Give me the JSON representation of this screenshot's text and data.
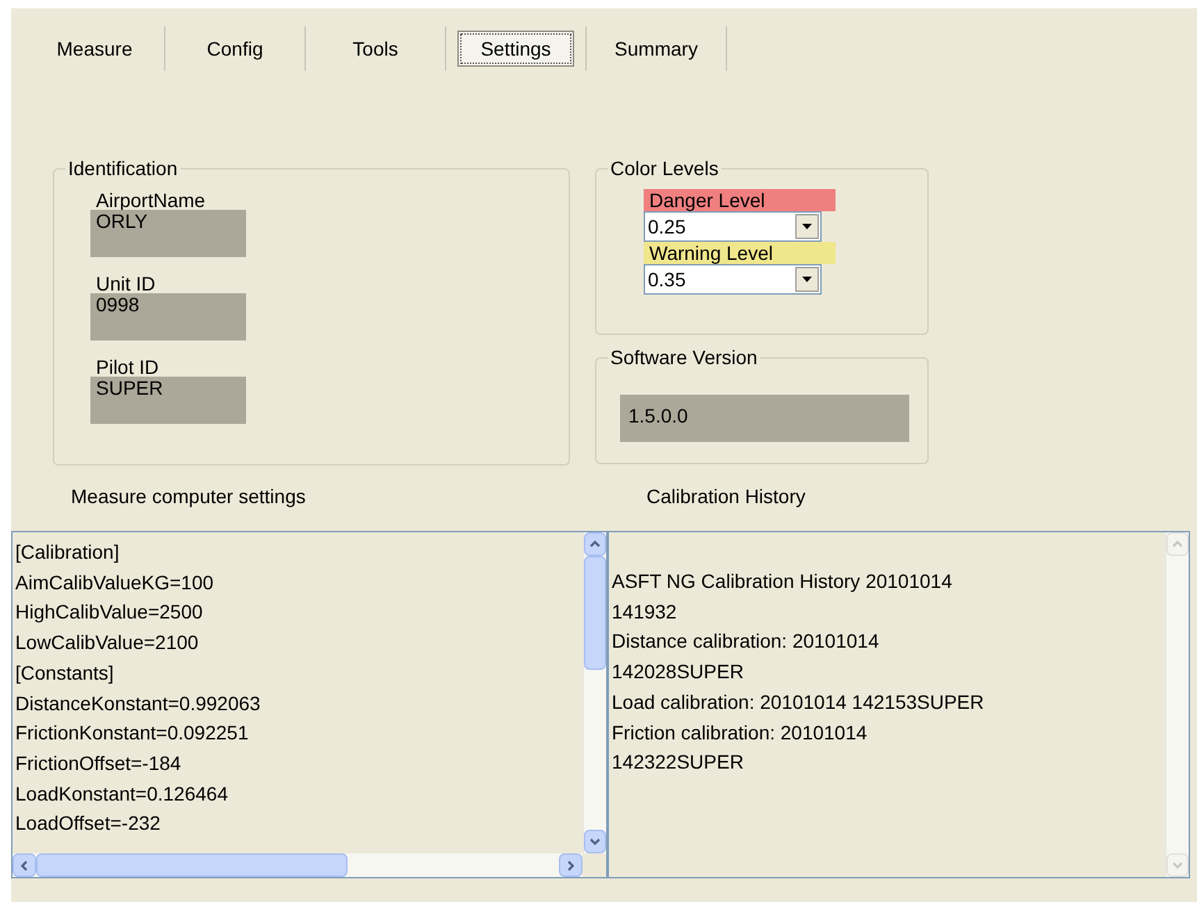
{
  "tabs": [
    {
      "label": "Measure",
      "selected": false
    },
    {
      "label": "Config",
      "selected": false
    },
    {
      "label": "Tools",
      "selected": false
    },
    {
      "label": "Settings",
      "selected": true
    },
    {
      "label": "Summary",
      "selected": false
    }
  ],
  "identification": {
    "title": "Identification",
    "fields": [
      {
        "label": "AirportName",
        "value": "ORLY"
      },
      {
        "label": "Unit ID",
        "value": "0998"
      },
      {
        "label": "Pilot ID",
        "value": "SUPER"
      }
    ]
  },
  "color_levels": {
    "title": "Color Levels",
    "levels": [
      {
        "label": "Danger Level",
        "color": "#f08080",
        "value": "0.25"
      },
      {
        "label": "Warning Level",
        "color": "#f0e68c",
        "value": "0.35"
      }
    ]
  },
  "software_version": {
    "title": "Software Version",
    "value": "1.5.0.0"
  },
  "measure_settings": {
    "title": "Measure computer settings",
    "lines": [
      "[Calibration]",
      "AimCalibValueKG=100",
      "HighCalibValue=2500",
      "LowCalibValue=2100",
      "[Constants]",
      "DistanceKonstant=0.992063",
      "FrictionKonstant=0.092251",
      "FrictionOffset=-184",
      "LoadKonstant=0.126464",
      "LoadOffset=-232"
    ]
  },
  "calibration_history": {
    "title": "Calibration History",
    "lines": [
      "ASFT NG Calibration History 20101014",
      "141932",
      "Distance calibration: 20101014",
      "142028SUPER",
      "Load calibration: 20101014 142153SUPER",
      "Friction calibration: 20101014",
      "142322SUPER"
    ]
  }
}
